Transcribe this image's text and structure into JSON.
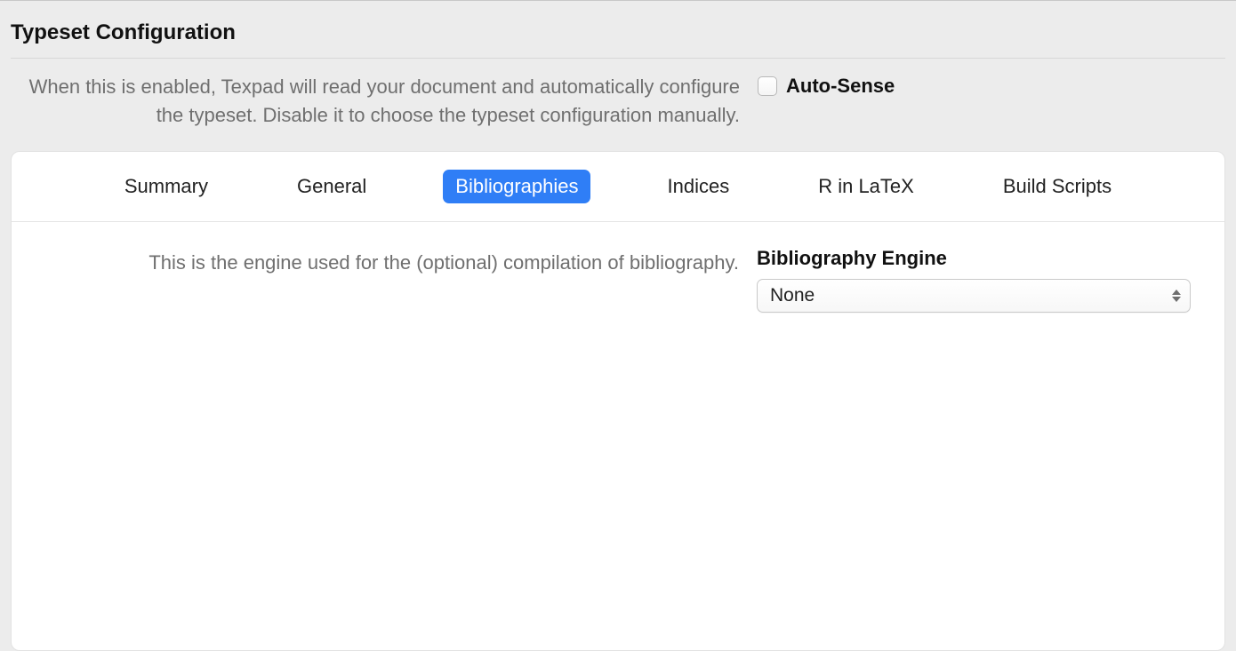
{
  "section_title": "Typeset Configuration",
  "auto_sense": {
    "description": "When this is enabled, Texpad will read your document and automatically configure the typeset. Disable it to choose the typeset configuration manually.",
    "label": "Auto-Sense",
    "checked": false
  },
  "tabs": {
    "items": [
      {
        "label": "Summary",
        "active": false
      },
      {
        "label": "General",
        "active": false
      },
      {
        "label": "Bibliographies",
        "active": true
      },
      {
        "label": "Indices",
        "active": false
      },
      {
        "label": "R in LaTeX",
        "active": false
      },
      {
        "label": "Build Scripts",
        "active": false
      }
    ]
  },
  "bibliography": {
    "description": "This is the engine used for the (optional) compilation of bibliography.",
    "label": "Bibliography Engine",
    "selected": "None"
  }
}
